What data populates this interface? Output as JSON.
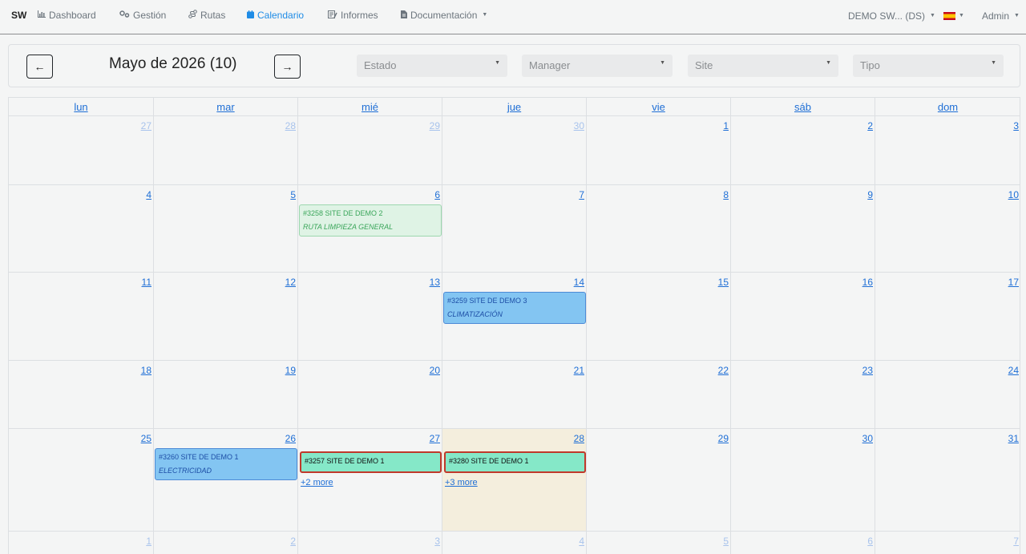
{
  "nav": {
    "brand": "SW",
    "items": [
      {
        "label": "Dashboard",
        "icon": "chart-icon"
      },
      {
        "label": "Gestión",
        "icon": "gears-icon"
      },
      {
        "label": "Rutas",
        "icon": "route-icon"
      },
      {
        "label": "Calendario",
        "icon": "calendar-icon",
        "active": true
      },
      {
        "label": "Informes",
        "icon": "report-icon"
      },
      {
        "label": "Documentación",
        "icon": "document-icon"
      }
    ],
    "company": "DEMO SW... (DS)",
    "user": "Admin"
  },
  "toolbar": {
    "prev": "←",
    "next": "→",
    "title": "Mayo de 2026 (10)",
    "filters": [
      "Estado",
      "Manager",
      "Site",
      "Tipo"
    ]
  },
  "calendar": {
    "weekdays": [
      "lun",
      "mar",
      "mié",
      "jue",
      "vie",
      "sáb",
      "dom"
    ],
    "weeks": [
      [
        "27",
        "28",
        "29",
        "30",
        "1",
        "2",
        "3"
      ],
      [
        "4",
        "5",
        "6",
        "7",
        "8",
        "9",
        "10"
      ],
      [
        "11",
        "12",
        "13",
        "14",
        "15",
        "16",
        "17"
      ],
      [
        "18",
        "19",
        "20",
        "21",
        "22",
        "23",
        "24"
      ],
      [
        "25",
        "26",
        "27",
        "28",
        "29",
        "30",
        "31"
      ],
      [
        "1",
        "2",
        "3",
        "4",
        "5",
        "6",
        "7"
      ]
    ],
    "events": {
      "e3258": {
        "title": "#3258 SITE DE DEMO 2",
        "subtitle": "RUTA LIMPIEZA GENERAL"
      },
      "e3259": {
        "title": "#3259 SITE DE DEMO 3",
        "subtitle": "CLIMATIZACIÓN"
      },
      "e3260": {
        "title": "#3260 SITE DE DEMO 1",
        "subtitle": "ELECTRICIDAD"
      },
      "e3257": {
        "title": "#3257 SITE DE DEMO 1"
      },
      "e3280": {
        "title": "#3280 SITE DE DEMO 1"
      }
    },
    "more_27": "+2 more",
    "more_28": "+3 more"
  }
}
